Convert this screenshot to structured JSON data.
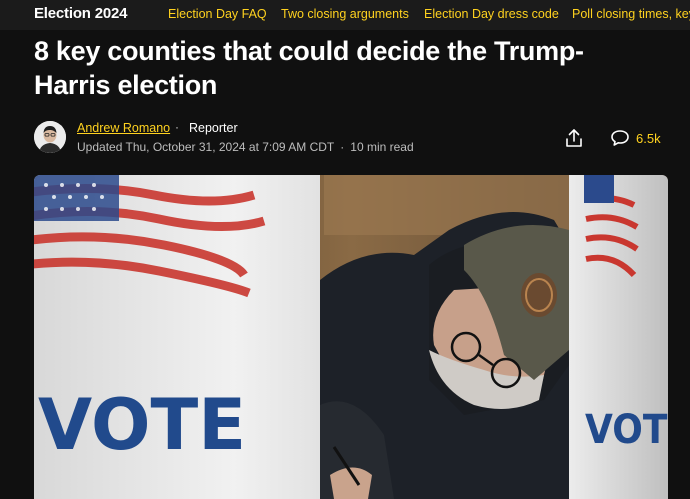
{
  "topbar": {
    "section_title": "Election 2024",
    "links": [
      "Election Day FAQ",
      "Two closing arguments",
      "Election Day dress code",
      "Poll closing times, key"
    ]
  },
  "article": {
    "headline": "8 key counties that could decide the Trump-Harris election",
    "author": "Andrew Romano",
    "separator": "·",
    "role": "Reporter",
    "updated": "Updated Thu, October 31, 2024 at 7:09 AM CDT",
    "read_time": "10 min read",
    "comment_count": "6.5k"
  },
  "photo": {
    "booth_text_left": "VOTE",
    "booth_text_right": "VOTE"
  },
  "colors": {
    "accent": "#ffd21f",
    "background": "#101010",
    "topbar": "#1b1b1b"
  },
  "icons": {
    "share": "share-icon",
    "comment": "comment-bubble-icon"
  }
}
